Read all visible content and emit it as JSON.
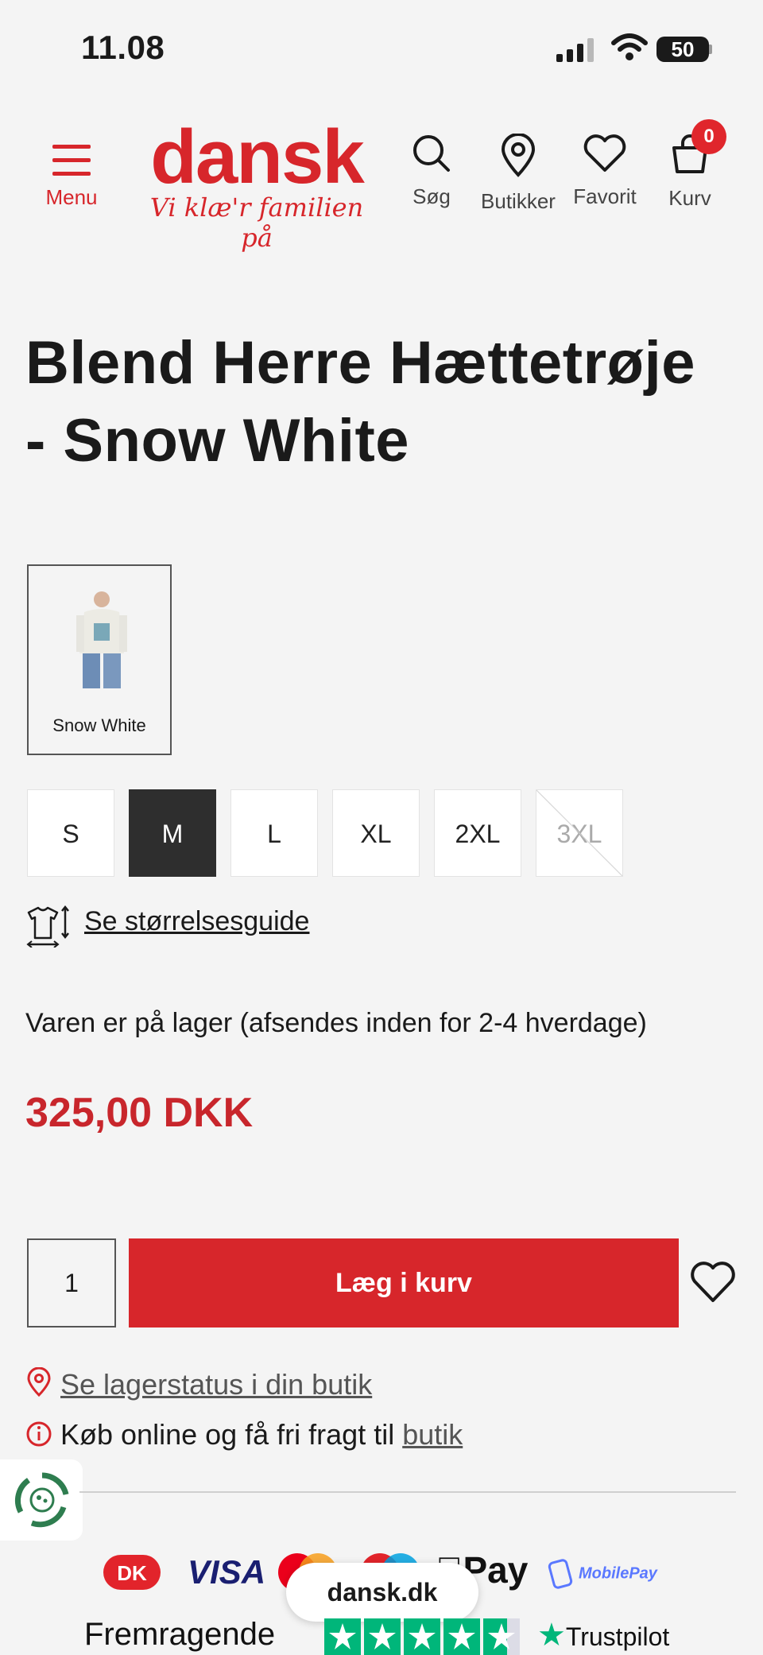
{
  "status_bar": {
    "time": "11.08",
    "battery": "50"
  },
  "header": {
    "menu_label": "Menu",
    "logo_text": "dansk",
    "logo_tagline": "Vi klæ'r familien på",
    "nav": [
      {
        "label": "Søg",
        "icon": "search-icon"
      },
      {
        "label": "Butikker",
        "icon": "location-pin-icon"
      },
      {
        "label": "Favorit",
        "icon": "heart-icon"
      },
      {
        "label": "Kurv",
        "icon": "shopping-bag-icon"
      }
    ],
    "cart_count": "0",
    "brand_color": "#d7262b"
  },
  "product": {
    "title_line1": "Blend Herre Hættetrøje",
    "title_line2": "- Snow White",
    "color_swatch_label": "Snow White",
    "sizes": [
      {
        "label": "S",
        "state": "available"
      },
      {
        "label": "M",
        "state": "selected"
      },
      {
        "label": "L",
        "state": "available"
      },
      {
        "label": "XL",
        "state": "available"
      },
      {
        "label": "2XL",
        "state": "available"
      },
      {
        "label": "3XL",
        "state": "sold-out"
      }
    ],
    "size_guide_link": "Se størrelsesguide",
    "stock_text": "Varen er på lager (afsendes inden for 2-4 hverdage)",
    "price": "325,00 DKK",
    "quantity": "1",
    "add_to_cart_label": "Læg i kurv",
    "store_stock_link": "Se lagerstatus i din butik",
    "free_shipping_text": "Køb online og få fri fragt til ",
    "free_shipping_link": "butik"
  },
  "footer": {
    "payment_methods": [
      "DK",
      "VISA",
      "Mastercard",
      "Maestro",
      "Pay",
      "MobilePay"
    ],
    "browser_pill": "dansk.dk",
    "trust_label": "Fremragende",
    "trustpilot_label": "Trustpilot",
    "trustpilot_color": "#00b67a"
  }
}
